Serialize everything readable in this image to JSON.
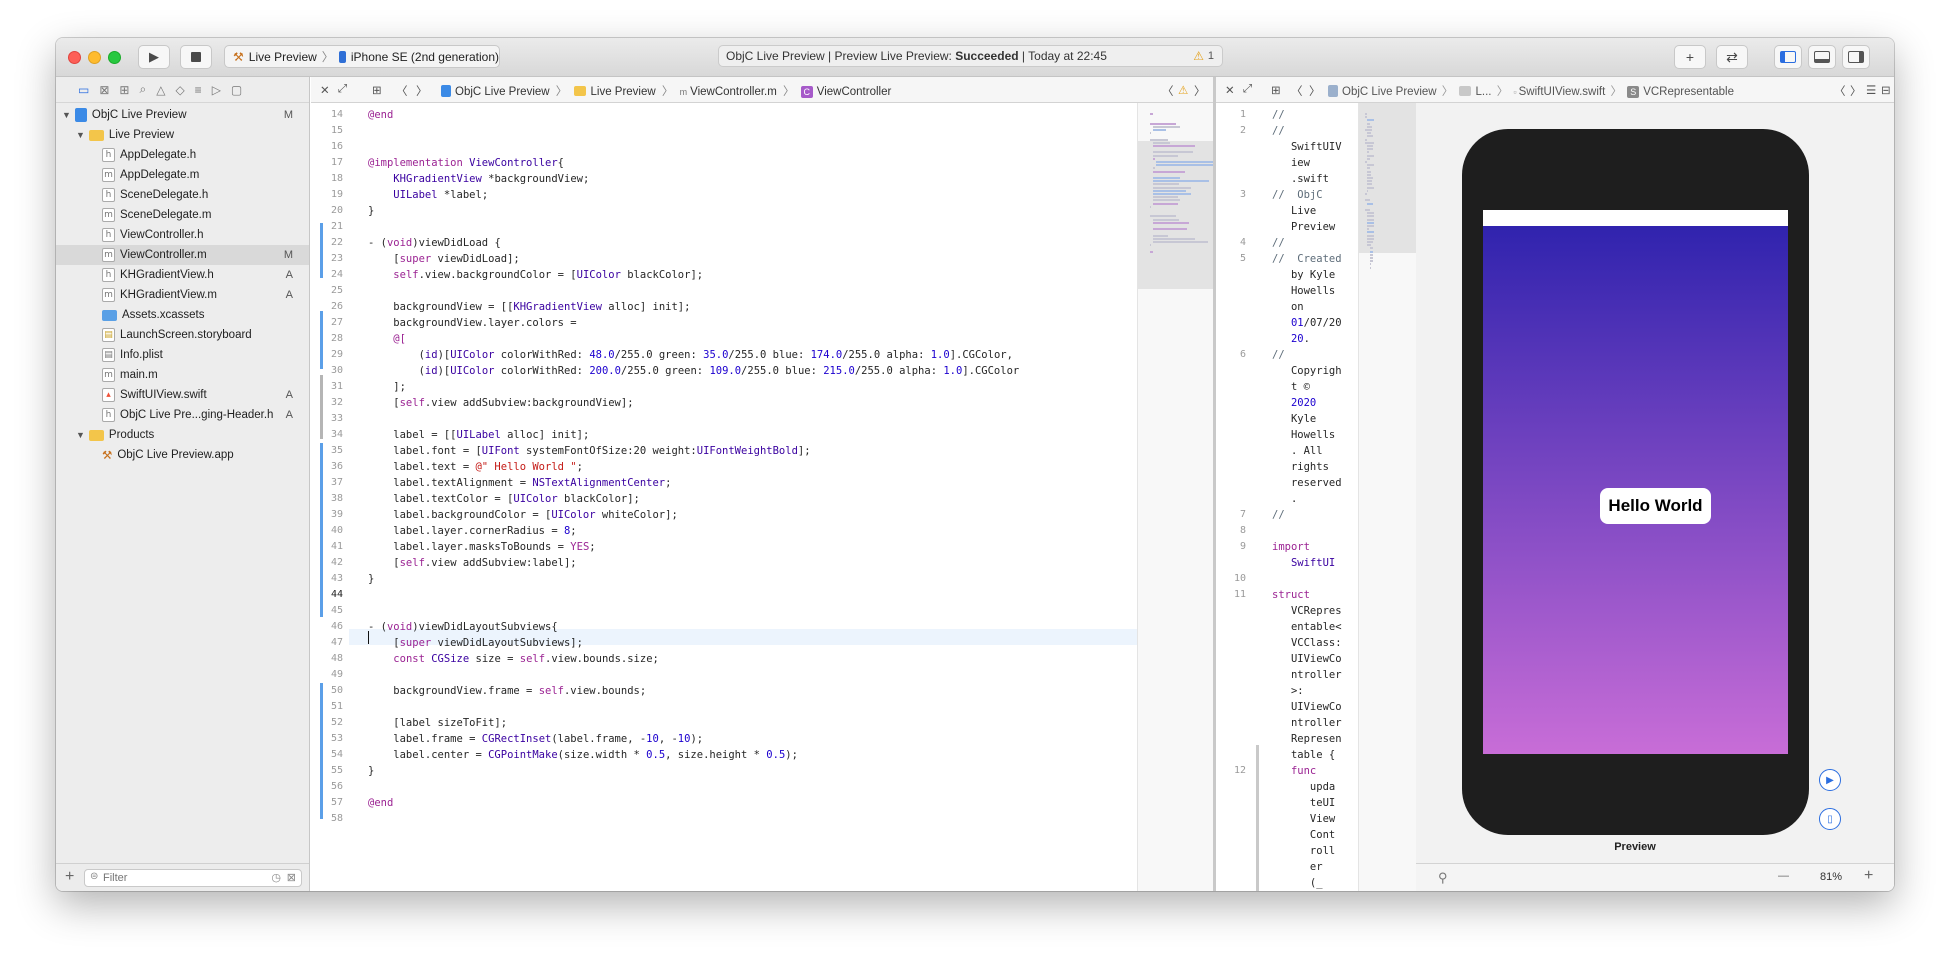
{
  "toolbar": {
    "scheme": "Live Preview",
    "device": "iPhone SE (2nd generation)",
    "status_prefix": "ObjC Live Preview | Preview Live Preview: ",
    "status_bold": "Succeeded",
    "status_suffix": " | Today at 22:45",
    "warning_count": "1",
    "add": "+",
    "swap": "⇄"
  },
  "navigator": {
    "project": "ObjC Live Preview",
    "project_badge": "M",
    "group": "Live Preview",
    "files": [
      {
        "name": "AppDelegate.h",
        "icon": "h",
        "badge": ""
      },
      {
        "name": "AppDelegate.m",
        "icon": "m",
        "badge": ""
      },
      {
        "name": "SceneDelegate.h",
        "icon": "h",
        "badge": ""
      },
      {
        "name": "SceneDelegate.m",
        "icon": "m",
        "badge": ""
      },
      {
        "name": "ViewController.h",
        "icon": "h",
        "badge": ""
      },
      {
        "name": "ViewController.m",
        "icon": "m",
        "badge": "M"
      },
      {
        "name": "KHGradientView.h",
        "icon": "h",
        "badge": "A"
      },
      {
        "name": "KHGradientView.m",
        "icon": "m",
        "badge": "A"
      },
      {
        "name": "Assets.xcassets",
        "icon": "folder",
        "badge": ""
      },
      {
        "name": "LaunchScreen.storyboard",
        "icon": "s",
        "badge": ""
      },
      {
        "name": "Info.plist",
        "icon": "p",
        "badge": ""
      },
      {
        "name": "main.m",
        "icon": "m",
        "badge": ""
      },
      {
        "name": "SwiftUIView.swift",
        "icon": "swift",
        "badge": "A"
      },
      {
        "name": "ObjC Live Pre...ging-Header.h",
        "icon": "h",
        "badge": "A"
      }
    ],
    "products_group": "Products",
    "product": "ObjC Live Preview.app",
    "filter_placeholder": "Filter"
  },
  "left_editor": {
    "jump_project": "ObjC Live Preview",
    "jump_group": "Live Preview",
    "jump_file": "ViewController.m",
    "jump_symbol": "ViewController",
    "lines": [
      {
        "n": "14",
        "t": "@end"
      },
      {
        "n": "15",
        "t": ""
      },
      {
        "n": "16",
        "t": ""
      },
      {
        "n": "17",
        "t": "@implementation ViewController{"
      },
      {
        "n": "18",
        "t": "    KHGradientView *backgroundView;"
      },
      {
        "n": "19",
        "t": "    UILabel *label;"
      },
      {
        "n": "20",
        "t": "}"
      },
      {
        "n": "21",
        "t": ""
      },
      {
        "n": "22",
        "t": "- (void)viewDidLoad {"
      },
      {
        "n": "23",
        "t": "    [super viewDidLoad];"
      },
      {
        "n": "24",
        "t": "    self.view.backgroundColor = [UIColor blackColor];"
      },
      {
        "n": "25",
        "t": ""
      },
      {
        "n": "26",
        "t": "    backgroundView = [[KHGradientView alloc] init];"
      },
      {
        "n": "27",
        "t": "    backgroundView.layer.colors ="
      },
      {
        "n": "28",
        "t": "    @["
      },
      {
        "n": "29",
        "t": "        (id)[UIColor colorWithRed: 48.0/255.0 green: 35.0/255.0 blue: 174.0/255.0 alpha: 1.0].CGColor,"
      },
      {
        "n": "30",
        "t": "        (id)[UIColor colorWithRed: 200.0/255.0 green: 109.0/255.0 blue: 215.0/255.0 alpha: 1.0].CGColor"
      },
      {
        "n": "31",
        "t": "    ];"
      },
      {
        "n": "32",
        "t": "    [self.view addSubview:backgroundView];"
      },
      {
        "n": "33",
        "t": ""
      },
      {
        "n": "34",
        "t": "    label = [[UILabel alloc] init];"
      },
      {
        "n": "35",
        "t": "    label.font = [UIFont systemFontOfSize:20 weight:UIFontWeightBold];"
      },
      {
        "n": "36",
        "t": "    label.text = @\" Hello World \";"
      },
      {
        "n": "37",
        "t": "    label.textAlignment = NSTextAlignmentCenter;"
      },
      {
        "n": "38",
        "t": "    label.textColor = [UIColor blackColor];"
      },
      {
        "n": "39",
        "t": "    label.backgroundColor = [UIColor whiteColor];"
      },
      {
        "n": "40",
        "t": "    label.layer.cornerRadius = 8;"
      },
      {
        "n": "41",
        "t": "    label.layer.masksToBounds = YES;"
      },
      {
        "n": "42",
        "t": "    [self.view addSubview:label];"
      },
      {
        "n": "43",
        "t": "}"
      },
      {
        "n": "44",
        "t": ""
      },
      {
        "n": "45",
        "t": ""
      },
      {
        "n": "46",
        "t": "- (void)viewDidLayoutSubviews{"
      },
      {
        "n": "47",
        "t": "    [super viewDidLayoutSubviews];"
      },
      {
        "n": "48",
        "t": "    const CGSize size = self.view.bounds.size;"
      },
      {
        "n": "49",
        "t": ""
      },
      {
        "n": "50",
        "t": "    backgroundView.frame = self.view.bounds;"
      },
      {
        "n": "51",
        "t": ""
      },
      {
        "n": "52",
        "t": "    [label sizeToFit];"
      },
      {
        "n": "53",
        "t": "    label.frame = CGRectInset(label.frame, -10, -10);"
      },
      {
        "n": "54",
        "t": "    label.center = CGPointMake(size.width * 0.5, size.height * 0.5);"
      },
      {
        "n": "55",
        "t": "}"
      },
      {
        "n": "56",
        "t": ""
      },
      {
        "n": "57",
        "t": "@end"
      },
      {
        "n": "58",
        "t": ""
      }
    ]
  },
  "right_editor": {
    "jump_project": "ObjC Live Preview",
    "jump_group": "L...",
    "jump_file": "SwiftUIView.swift",
    "jump_symbol": "VCRepresentable",
    "lines": [
      {
        "n": "1",
        "t": "//"
      },
      {
        "n": "2",
        "t": "//"
      },
      {
        "n": "",
        "t": "   SwiftUIV"
      },
      {
        "n": "",
        "t": "   iew"
      },
      {
        "n": "",
        "t": "   .swift"
      },
      {
        "n": "3",
        "t": "//  ObjC"
      },
      {
        "n": "",
        "t": "   Live"
      },
      {
        "n": "",
        "t": "   Preview"
      },
      {
        "n": "4",
        "t": "//"
      },
      {
        "n": "5",
        "t": "//  Created"
      },
      {
        "n": "",
        "t": "   by Kyle"
      },
      {
        "n": "",
        "t": "   Howells"
      },
      {
        "n": "",
        "t": "   on"
      },
      {
        "n": "",
        "t": "   01/07/20"
      },
      {
        "n": "",
        "t": "   20."
      },
      {
        "n": "6",
        "t": "//"
      },
      {
        "n": "",
        "t": "   Copyrigh"
      },
      {
        "n": "",
        "t": "   t ©"
      },
      {
        "n": "",
        "t": "   2020"
      },
      {
        "n": "",
        "t": "   Kyle"
      },
      {
        "n": "",
        "t": "   Howells"
      },
      {
        "n": "",
        "t": "   . All"
      },
      {
        "n": "",
        "t": "   rights"
      },
      {
        "n": "",
        "t": "   reserved"
      },
      {
        "n": "",
        "t": "   ."
      },
      {
        "n": "7",
        "t": "//"
      },
      {
        "n": "8",
        "t": ""
      },
      {
        "n": "9",
        "t": "import"
      },
      {
        "n": "",
        "t": "   SwiftUI"
      },
      {
        "n": "10",
        "t": ""
      },
      {
        "n": "11",
        "t": "struct"
      },
      {
        "n": "",
        "t": "   VCRepres"
      },
      {
        "n": "",
        "t": "   entable<"
      },
      {
        "n": "",
        "t": "   VCClass:"
      },
      {
        "n": "",
        "t": "   UIViewCo"
      },
      {
        "n": "",
        "t": "   ntroller"
      },
      {
        "n": "",
        "t": "   >:"
      },
      {
        "n": "",
        "t": "   UIViewCo"
      },
      {
        "n": "",
        "t": "   ntroller"
      },
      {
        "n": "",
        "t": "   Represen"
      },
      {
        "n": "",
        "t": "   table {"
      },
      {
        "n": "12",
        "t": "   func"
      },
      {
        "n": "",
        "t": "      upda"
      },
      {
        "n": "",
        "t": "      teUI"
      },
      {
        "n": "",
        "t": "      View"
      },
      {
        "n": "",
        "t": "      Cont"
      },
      {
        "n": "",
        "t": "      roll"
      },
      {
        "n": "",
        "t": "      er"
      },
      {
        "n": "",
        "t": "      (_"
      }
    ]
  },
  "preview": {
    "label": "Hello World",
    "caption": "Preview",
    "zoom": "81%",
    "zoom_out": "—",
    "zoom_in": "+"
  },
  "colors": {
    "gradient_top": "#3023ae",
    "gradient_bottom": "#c86dd7",
    "accent": "#2a6de0"
  }
}
